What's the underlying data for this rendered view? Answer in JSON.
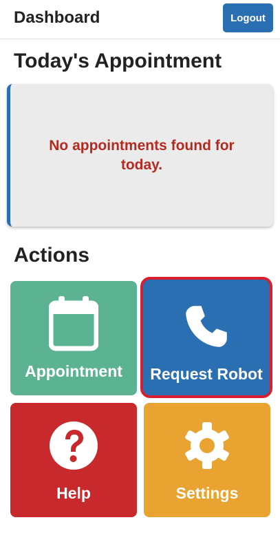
{
  "header": {
    "title": "Dashboard",
    "logout_label": "Logout"
  },
  "appointment": {
    "heading": "Today's Appointment",
    "message": "No appointments found for today."
  },
  "actions": {
    "heading": "Actions",
    "tiles": [
      {
        "label": "Appointment",
        "icon": "calendar-icon",
        "color": "#5cb391"
      },
      {
        "label": "Request Robot",
        "icon": "phone-icon",
        "color": "#2b6fb3",
        "highlight_color": "#d81e2f"
      },
      {
        "label": "Help",
        "icon": "question-circle-icon",
        "color": "#c8292d"
      },
      {
        "label": "Settings",
        "icon": "gear-icon",
        "color": "#e8a330"
      }
    ]
  }
}
